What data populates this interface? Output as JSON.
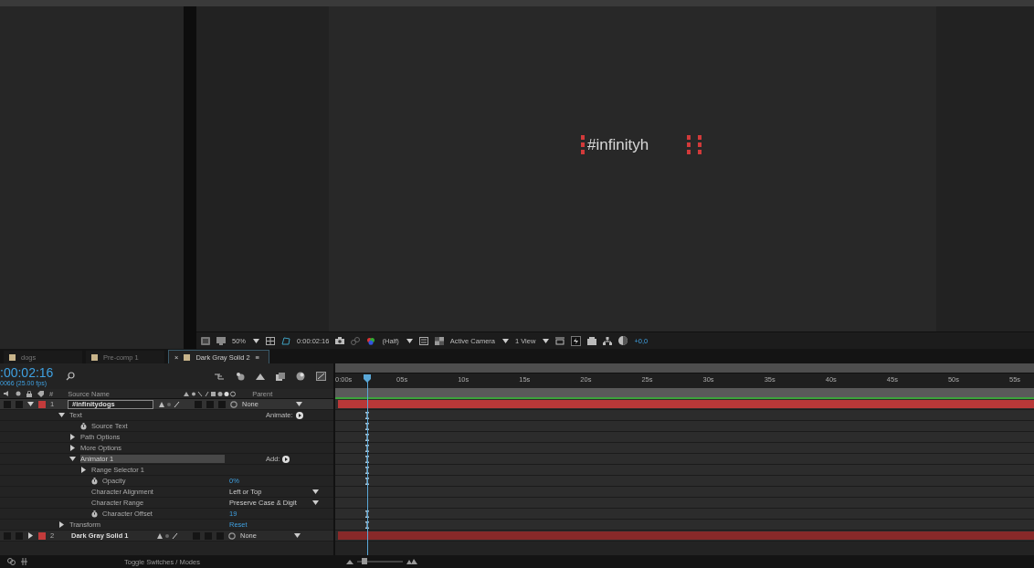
{
  "viewer": {
    "canvas_text": "#infinityh",
    "toolbar": {
      "magnification": "50%",
      "timecode": "0:00:02:16",
      "resolution": "(Half)",
      "camera": "Active Camera",
      "view_layout": "1 View",
      "exposure": "+0,0"
    }
  },
  "tabs": [
    {
      "label": "dogs",
      "selected": false,
      "color": "#c8b48a"
    },
    {
      "label": "Pre-comp 1",
      "selected": false,
      "color": "#c8b48a"
    },
    {
      "label": "Dark Gray Solid 2",
      "selected": true,
      "color": "#c8b48a",
      "close": "×",
      "menu": "≡"
    }
  ],
  "timeline": {
    "timecode": ":00:02:16",
    "frame_info": "0066 (25.00 fps)",
    "columns": {
      "number": "#",
      "name": "Source Name",
      "parent": "Parent"
    },
    "ruler": [
      "0:00s",
      "05s",
      "10s",
      "15s",
      "20s",
      "25s",
      "30s",
      "35s",
      "40s",
      "45s",
      "50s",
      "55s"
    ],
    "playhead": {
      "level": 0.046
    },
    "layers": [
      {
        "number": "1",
        "name": "#infinitydogs",
        "parent": "None",
        "color": "#c23b3b",
        "selected": true,
        "expanded": true,
        "children": [
          {
            "kind": "group",
            "label": "Text",
            "expanded": true,
            "action": "Animate:",
            "selected": false,
            "keyframe": true,
            "children": [
              {
                "kind": "property",
                "label": "Source Text",
                "stopwatch": true,
                "selected": false,
                "keyframe": true
              },
              {
                "kind": "group",
                "label": "Path Options",
                "expanded": false,
                "selected": false,
                "keyframe": true
              },
              {
                "kind": "group",
                "label": "More Options",
                "expanded": false,
                "selected": false,
                "keyframe": true
              },
              {
                "kind": "group",
                "label": "Animator 1",
                "expanded": true,
                "action": "Add:",
                "selected": true,
                "keyframe": true,
                "children": [
                  {
                    "kind": "group",
                    "label": "Range Selector 1",
                    "expanded": false,
                    "selected": false,
                    "keyframe": true
                  },
                  {
                    "kind": "property",
                    "label": "Opacity",
                    "stopwatch": true,
                    "value": "0%",
                    "selected": false,
                    "keyframe": true
                  },
                  {
                    "kind": "dropdown",
                    "label": "Character Alignment",
                    "value": "Left or Top",
                    "selected": false,
                    "keyframe": false
                  },
                  {
                    "kind": "dropdown",
                    "label": "Character Range",
                    "value": "Preserve Case & Digit",
                    "selected": false,
                    "keyframe": false
                  },
                  {
                    "kind": "property",
                    "label": "Character Offset",
                    "stopwatch": true,
                    "value": "19",
                    "selected": false,
                    "keyframe": true
                  }
                ]
              }
            ]
          },
          {
            "kind": "group",
            "label": "Transform",
            "expanded": false,
            "value": "Reset",
            "selected": false,
            "keyframe": true
          }
        ]
      },
      {
        "number": "2",
        "name": "Dark Gray Solid 1",
        "parent": "None",
        "color": "#c23b3b",
        "selected": false,
        "expanded": false
      }
    ],
    "toggle_label": "Toggle Switches / Modes",
    "zoom_slider": {
      "level": 0.15
    }
  }
}
